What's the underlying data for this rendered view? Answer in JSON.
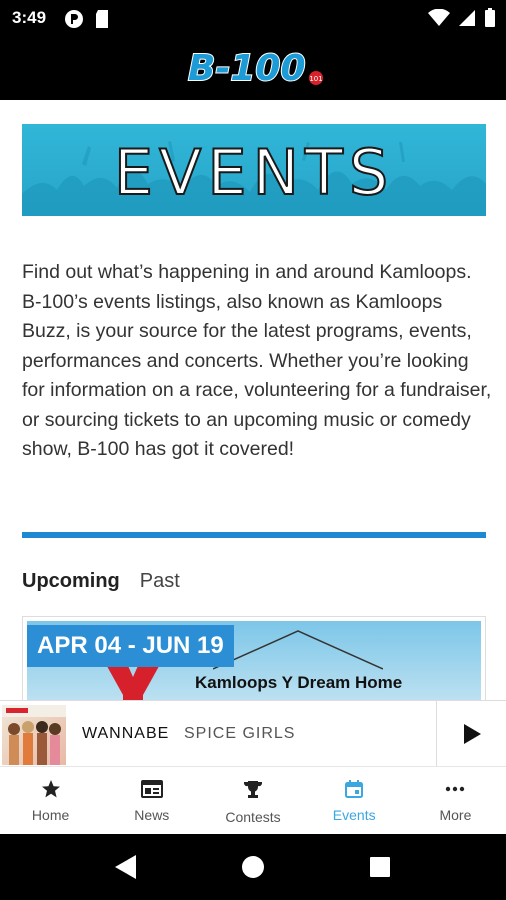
{
  "status": {
    "time": "3:49"
  },
  "logo": {
    "text": "B-100",
    "sub": "101"
  },
  "banner": {
    "title": "EVENTS"
  },
  "intro": {
    "text": "Find out what’s happening in and around Kamloops. B-100’s events listings, also known as Kamloops Buzz, is your source for the latest programs, events, performances and concerts. Whether you’re looking for information on a race, volunteering for a fundraiser, or sourcing tickets to an upcoming music or comedy show, B-100 has got it covered!"
  },
  "tabs": [
    {
      "label": "Upcoming",
      "active": true
    },
    {
      "label": "Past",
      "active": false
    }
  ],
  "event": {
    "date_badge": "APR 04 - JUN 19",
    "title": "Kamloops Y Dream Home"
  },
  "player": {
    "song": "WANNABE",
    "artist": "SPICE GIRLS"
  },
  "nav": [
    {
      "label": "Home",
      "icon": "star-icon"
    },
    {
      "label": "News",
      "icon": "news-icon"
    },
    {
      "label": "Contests",
      "icon": "trophy-icon"
    },
    {
      "label": "Events",
      "icon": "calendar-icon",
      "active": true
    },
    {
      "label": "More",
      "icon": "more-icon"
    }
  ],
  "colors": {
    "accent": "#3aa7e0",
    "divider": "#1e88d2",
    "banner": "#2eb0d4",
    "badge": "#2c8fd6"
  }
}
